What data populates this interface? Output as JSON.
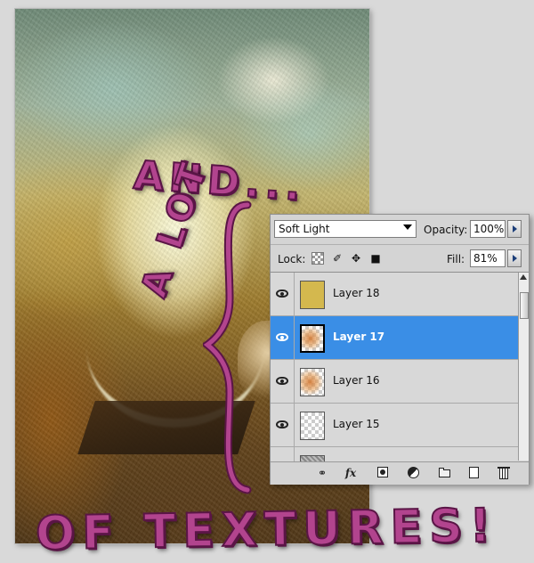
{
  "artwork": {
    "annotation_and": "AND...",
    "annotation_alot": "A LOT",
    "annotation_textures": "OF TEXTURES!"
  },
  "layers_panel": {
    "blend_mode": "Soft Light",
    "opacity_label": "Opacity:",
    "opacity_value": "100%",
    "lock_label": "Lock:",
    "fill_label": "Fill:",
    "fill_value": "81%",
    "layers": [
      {
        "name": "Layer 18",
        "visible": true,
        "thumbnail": "solid-gold"
      },
      {
        "name": "Layer 17",
        "visible": true,
        "thumbnail": "texture",
        "selected": true
      },
      {
        "name": "Layer 16",
        "visible": true,
        "thumbnail": "texture"
      },
      {
        "name": "Layer 15",
        "visible": true,
        "thumbnail": "transparent"
      }
    ],
    "footer": {
      "fx_label": "fx"
    }
  },
  "colors": {
    "selection": "#3a8ee6",
    "annotation": "#b2448e",
    "layer18_fill": "#d4b84e"
  },
  "icons": [
    "eye-icon",
    "lock-transparency-icon",
    "lock-brush-icon",
    "lock-move-icon",
    "lock-all-icon",
    "link-icon",
    "fx-icon",
    "mask-icon",
    "adjustment-icon",
    "group-icon",
    "new-layer-icon",
    "trash-icon"
  ]
}
